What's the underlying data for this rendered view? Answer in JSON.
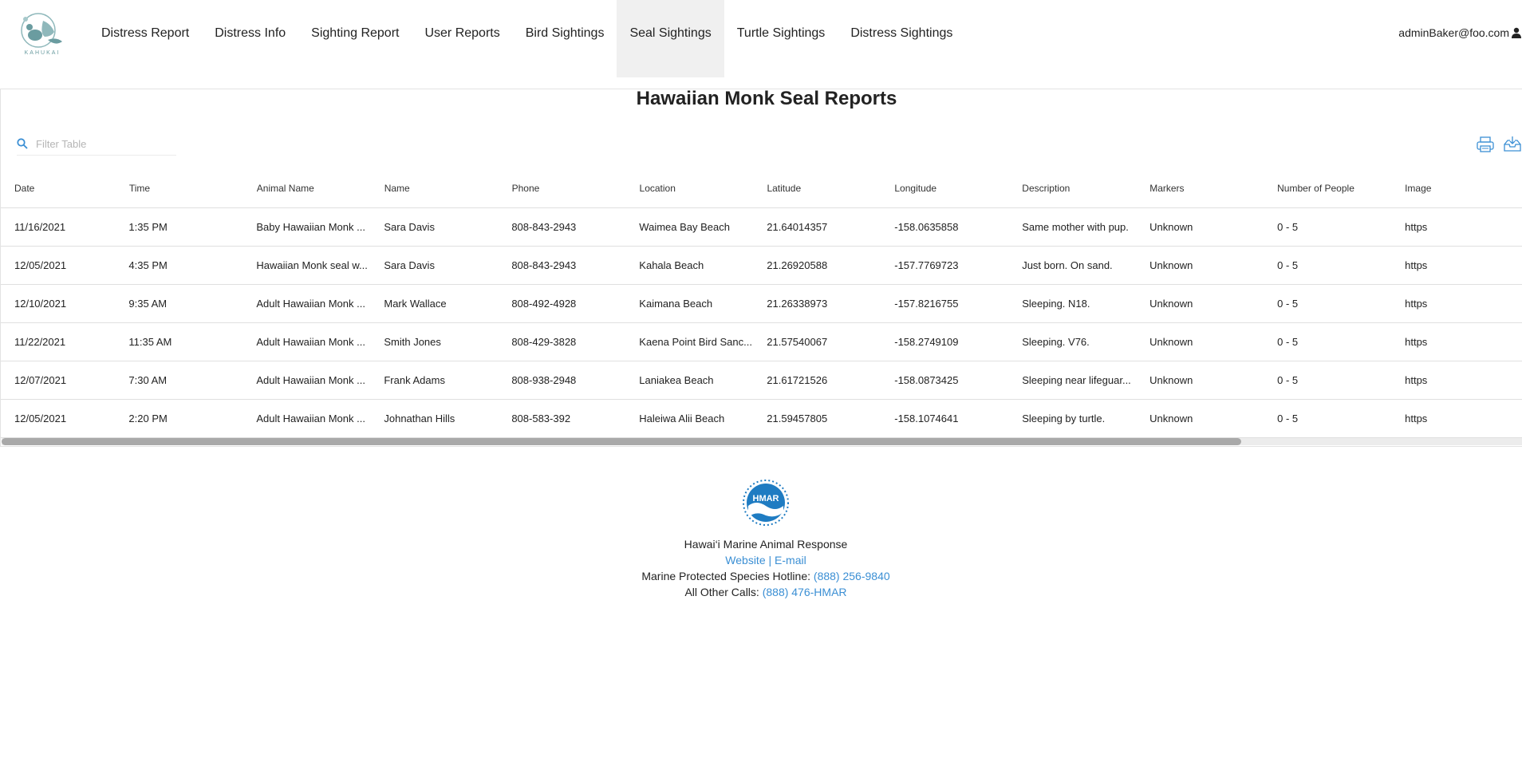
{
  "app": {
    "logo_text": "KAHUKAI"
  },
  "nav": {
    "items": [
      {
        "label": "Distress Report"
      },
      {
        "label": "Distress Info"
      },
      {
        "label": "Sighting Report"
      },
      {
        "label": "User Reports"
      },
      {
        "label": "Bird Sightings"
      },
      {
        "label": "Seal Sightings",
        "active": true
      },
      {
        "label": "Turtle Sightings"
      },
      {
        "label": "Distress Sightings"
      }
    ],
    "user": "adminBaker@foo.com"
  },
  "page": {
    "title": "Hawaiian Monk Seal Reports"
  },
  "filter": {
    "placeholder": "Filter Table"
  },
  "table": {
    "columns": [
      "Date",
      "Time",
      "Animal Name",
      "Name",
      "Phone",
      "Location",
      "Latitude",
      "Longitude",
      "Description",
      "Markers",
      "Number of People",
      "Image"
    ],
    "rows": [
      [
        "11/16/2021",
        "1:35 PM",
        "Baby Hawaiian Monk ...",
        "Sara Davis",
        "808-843-2943",
        "Waimea Bay Beach",
        "21.64014357",
        "-158.0635858",
        "Same mother with pup.",
        "Unknown",
        "0 - 5",
        "https"
      ],
      [
        "12/05/2021",
        "4:35 PM",
        "Hawaiian Monk seal w...",
        "Sara Davis",
        "808-843-2943",
        "Kahala Beach",
        "21.26920588",
        "-157.7769723",
        "Just born. On sand.",
        "Unknown",
        "0 - 5",
        "https"
      ],
      [
        "12/10/2021",
        "9:35 AM",
        "Adult Hawaiian Monk ...",
        "Mark Wallace",
        "808-492-4928",
        "Kaimana Beach",
        "21.26338973",
        "-157.8216755",
        "Sleeping. N18.",
        "Unknown",
        "0 - 5",
        "https"
      ],
      [
        "11/22/2021",
        "11:35 AM",
        "Adult Hawaiian Monk ...",
        "Smith Jones",
        "808-429-3828",
        "Kaena Point Bird Sanc...",
        "21.57540067",
        "-158.2749109",
        "Sleeping. V76.",
        "Unknown",
        "0 - 5",
        "https"
      ],
      [
        "12/07/2021",
        "7:30 AM",
        "Adult Hawaiian Monk ...",
        "Frank Adams",
        "808-938-2948",
        "Laniakea Beach",
        "21.61721526",
        "-158.0873425",
        "Sleeping near lifeguar...",
        "Unknown",
        "0 - 5",
        "https"
      ],
      [
        "12/05/2021",
        "2:20 PM",
        "Adult Hawaiian Monk ...",
        "Johnathan Hills",
        "808-583-392",
        "Haleiwa Alii Beach",
        "21.59457805",
        "-158.1074641",
        "Sleeping by turtle.",
        "Unknown",
        "0 - 5",
        "https"
      ]
    ]
  },
  "footer": {
    "logo_text": "HMAR",
    "org": "Hawai‘i Marine Animal Response",
    "website": "Website",
    "separator": "|",
    "email": "E-mail",
    "hotline_label": "Marine Protected Species Hotline:",
    "hotline": "(888) 256-9840",
    "other_label": "All Other Calls:",
    "other": "(888) 476-HMAR"
  },
  "colors": {
    "accent": "#3b8fd4",
    "active_tab": "#f0f0f0",
    "logo_teal": "#6a9ca0",
    "hmar_blue": "#1f7cc2"
  },
  "icons": {
    "search": "search-icon",
    "print": "print-icon",
    "download": "download-icon",
    "user": "user-icon"
  }
}
